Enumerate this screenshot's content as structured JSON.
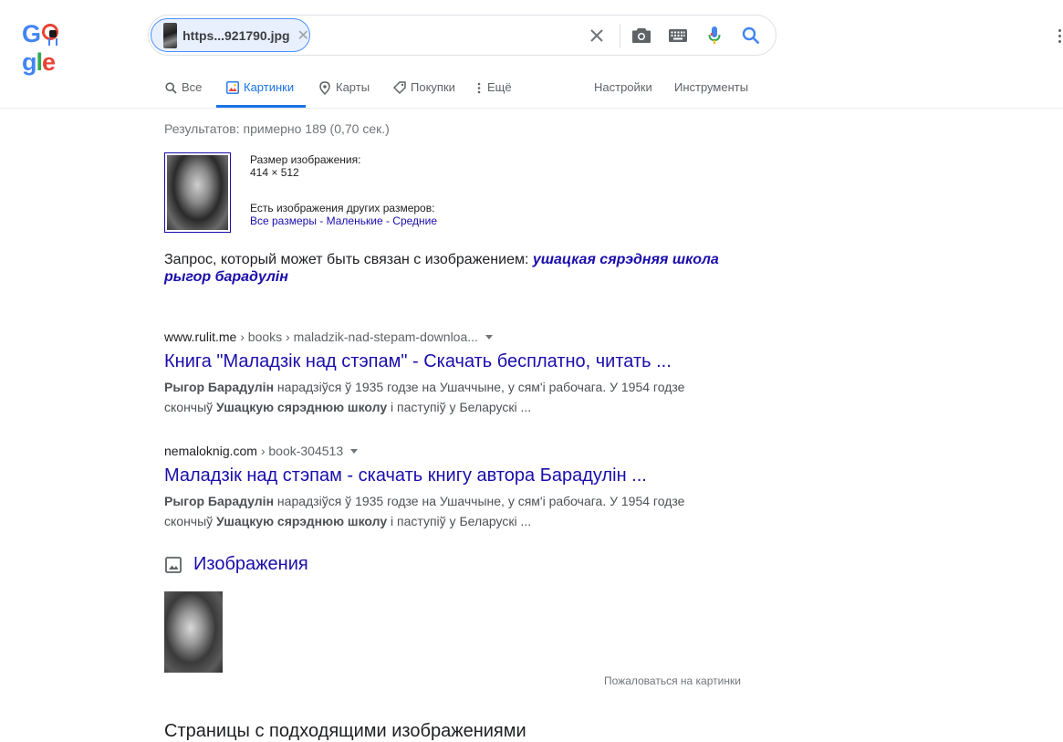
{
  "header": {
    "logo_text": "Google",
    "search_chip_label": "https...921790.jpg",
    "icons": [
      "clear-icon",
      "camera-icon",
      "keyboard-icon",
      "mic-icon",
      "search-icon",
      "more-vert-icon"
    ]
  },
  "tabs": [
    {
      "label": "Все",
      "icon": "search-icon"
    },
    {
      "label": "Картинки",
      "icon": "image-icon",
      "active": true
    },
    {
      "label": "Карты",
      "icon": "map-pin-icon"
    },
    {
      "label": "Покупки",
      "icon": "tag-icon"
    },
    {
      "label": "Ещё",
      "icon": "more-vert-icon"
    },
    {
      "label": "Настройки"
    },
    {
      "label": "Инструменты"
    }
  ],
  "stats": "Результатов: примерно 189 (0,70 сек.)",
  "image_info": {
    "size_label": "Размер изображения:",
    "size_value": "414 × 512",
    "other_sizes_label": "Есть изображения других размеров:",
    "links": [
      "Все размеры",
      "Маленькие",
      "Средние"
    ],
    "separator": " - "
  },
  "related": {
    "prefix": "Запрос, который может быть связан с изображением: ",
    "query": "ушацкая сярэдняя школа рыгор барадулін"
  },
  "results": [
    {
      "domain": "www.rulit.me",
      "path": " › books › maladzik-nad-stepam-downloa...",
      "title": "Книга \"Маладзік над стэпам\" - Скачать бесплатно, читать ...",
      "snippet_parts": [
        {
          "b": "Рыгор Барадулін"
        },
        {
          "t": " нарадзіўся ў 1935 годзе на Ушаччыне, у сям'і рабочага. У 1954 годзе скончыў "
        },
        {
          "b": "Ушацкую сярэднюю школу"
        },
        {
          "t": " і паступіў у Беларускі ..."
        }
      ]
    },
    {
      "domain": "nemaloknig.com",
      "path": " › book-304513",
      "title": "Маладзік над стэпам - скачать книгу автора Барадулін ...",
      "snippet_parts": [
        {
          "b": "Рыгор Барадулін"
        },
        {
          "t": " нарадзіўся ў 1935 годзе на Ушаччыне, у сям'і рабочага. У 1954 годзе скончыў "
        },
        {
          "b": "Ушацкую сярэднюю школу"
        },
        {
          "t": " і паступіў у Беларускі ..."
        }
      ]
    }
  ],
  "images_section": {
    "heading": "Изображения",
    "report_link": "Пожаловаться на картинки"
  },
  "next_section_heading": "Страницы с подходящими изображениями",
  "colors": {
    "link": "#1a0dab",
    "accent": "#1a73e8",
    "muted": "#70757a"
  }
}
